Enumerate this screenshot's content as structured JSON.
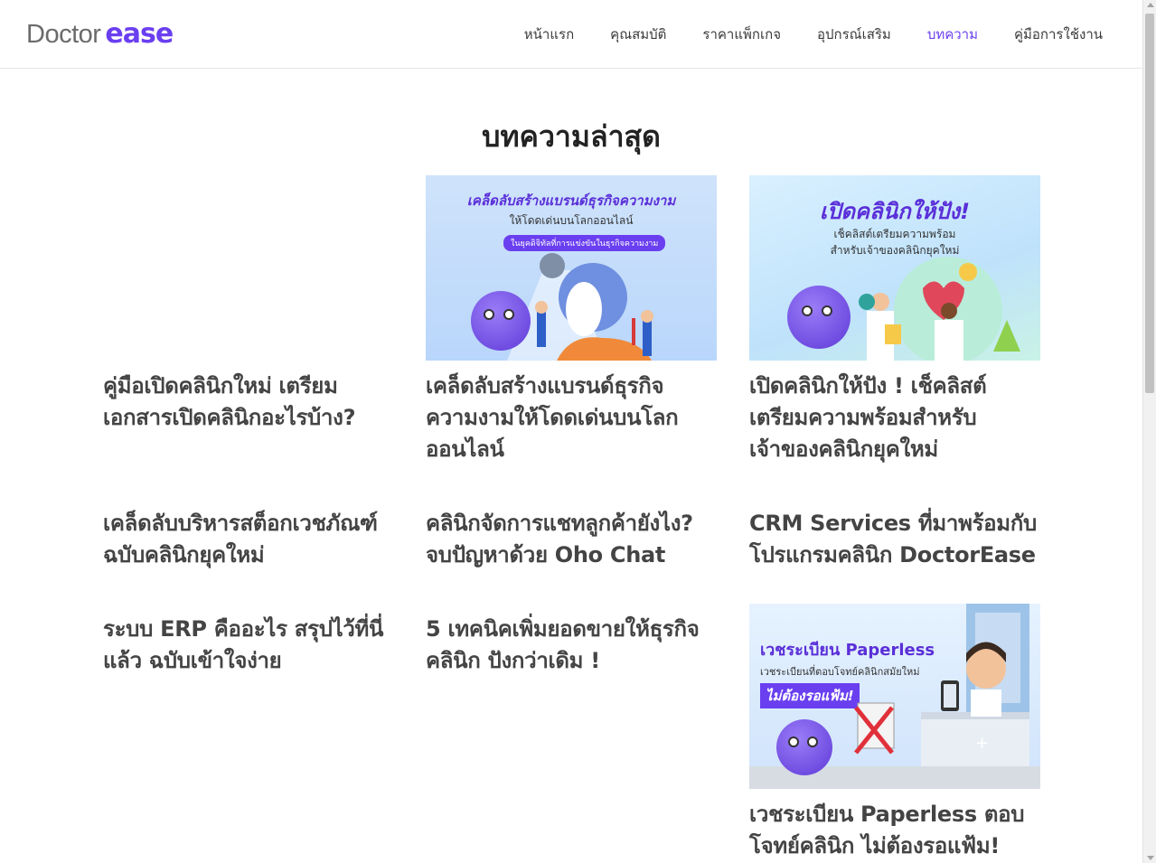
{
  "brand": {
    "doctor": "Doctor",
    "ease": "ease",
    "accent": "#6a3ff0"
  },
  "nav": [
    {
      "label": "หน้าแรก"
    },
    {
      "label": "คุณสมบัติ"
    },
    {
      "label": "ราคาแพ็กเกจ"
    },
    {
      "label": "อุปกรณ์เสริม"
    },
    {
      "label": "บทความ",
      "active": true
    },
    {
      "label": "คู่มือการใช้งาน"
    }
  ],
  "section": {
    "title": "บทความล่าสุด"
  },
  "articles": [
    {
      "title": "คู่มือเปิดคลินิกใหม่ เตรียมเอกสารเปิดคลินิกอะไรบ้าง?",
      "lines": [
        "คู่มือเปิดคลินิกใหม่ เตรียม",
        "เอกสารเปิดคลินิกอะไรบ้าง?"
      ]
    },
    {
      "title": "เคล็ดลับสร้างแบรนด์ธุรกิจความงามให้โดดเด่นบนโลกออนไลน์",
      "lines": [
        "เคล็ดลับสร้างแบรนด์ธุรกิจ",
        "ความงามให้โดดเด่นบนโลก",
        "ออนไลน์"
      ],
      "image": {
        "headline": "เคล็ดลับสร้างแบรนด์ธุรกิจความงาม",
        "sub": "ให้โดดเด่นบนโลกออนไลน์",
        "pill": "ในยุคดิจิทัลที่การแข่งขันในธุรกิจความงาม"
      }
    },
    {
      "title": "เปิดคลินิกให้ปัง ! เช็คลิสต์เตรียมความพร้อมสำหรับเจ้าของคลินิกยุคใหม่",
      "lines": [
        "เปิดคลินิกให้ปัง ! เช็คลิสต์",
        "เตรียมความพร้อมสำหรับ",
        "เจ้าของคลินิกยุคใหม่"
      ],
      "image": {
        "headline": "เปิดคลินิกให้ปัง!",
        "sub1": "เช็คลิสต์เตรียมความพร้อม",
        "sub2": "สำหรับเจ้าของคลินิกยุคใหม่"
      }
    },
    {
      "title": "เคล็ดลับบริหารสต็อกเวชภัณฑ์ ฉบับคลินิกยุคใหม่",
      "lines": [
        "เคล็ดลับบริหารสต็อกเวชภัณฑ์",
        "ฉบับคลินิกยุคใหม่"
      ]
    },
    {
      "title": "คลินิกจัดการแชทลูกค้ายังไง? จบปัญหาด้วย Oho Chat",
      "lines": [
        "คลินิกจัดการแชทลูกค้ายังไง?",
        "จบปัญหาด้วย Oho Chat"
      ]
    },
    {
      "title": "CRM Services ที่มาพร้อมกับโปรแกรมคลินิก DoctorEase",
      "lines": [
        "CRM Services ที่มาพร้อมกับ",
        "โปรแกรมคลินิก DoctorEase"
      ]
    },
    {
      "title": "ระบบ ERP คืออะไร สรุปไว้ที่นี่แล้ว ฉบับเข้าใจง่าย",
      "lines": [
        "ระบบ ERP คืออะไร สรุปไว้ที่นี่",
        "แล้ว ฉบับเข้าใจง่าย"
      ]
    },
    {
      "title": "5 เทคนิคเพิ่มยอดขายให้ธุรกิจคลินิก ปังกว่าเดิม !",
      "lines": [
        "5 เทคนิคเพิ่มยอดขายให้ธุรกิจ",
        "คลินิก ปังกว่าเดิม !"
      ]
    },
    {
      "title": "เวชระเบียน Paperless ตอบโจทย์คลินิก ไม่ต้องรอแฟ้ม!",
      "lines": [
        "เวชระเบียน Paperless ตอบ",
        "โจทย์คลินิก ไม่ต้องรอแฟ้ม!"
      ],
      "image": {
        "headline": "เวชระเบียน Paperless",
        "sub": "เวชระเบียนที่ตอบโจทย์คลินิกสมัยใหม่",
        "pill": "ไม่ต้องรอแฟ้ม!"
      }
    }
  ]
}
